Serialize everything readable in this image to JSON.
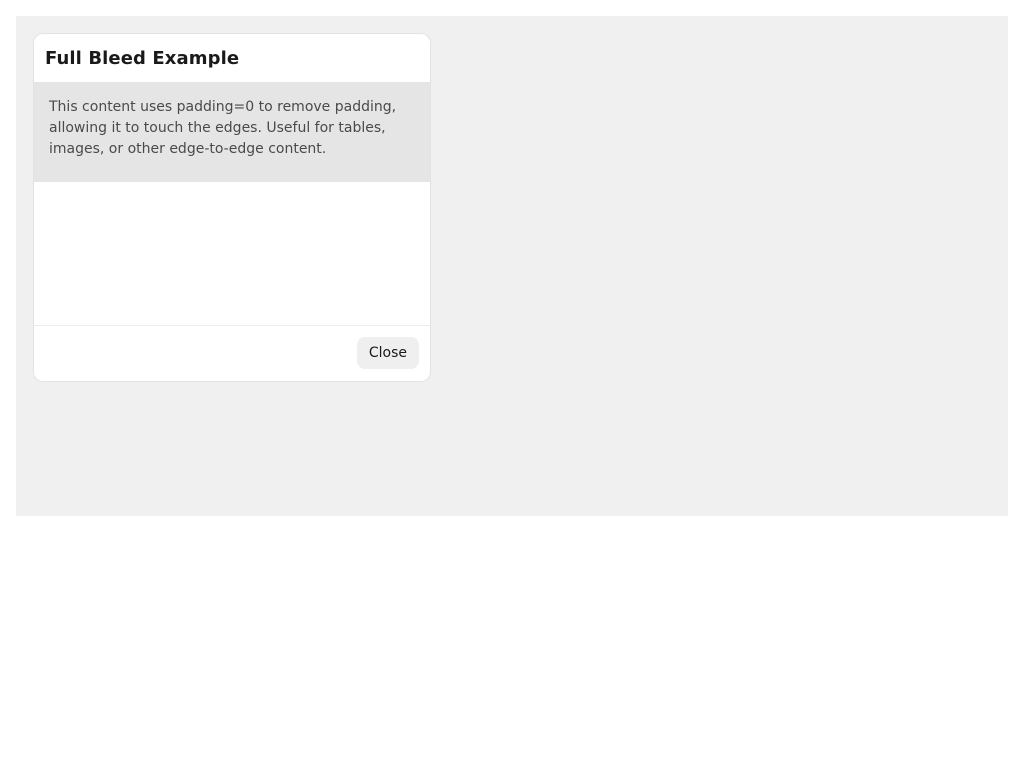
{
  "dialog": {
    "title": "Full Bleed Example",
    "content_text": "This content uses padding=0 to remove padding, allowing it to touch the edges. Useful for tables, images, or other edge-to-edge content.",
    "close_label": "Close"
  },
  "colors": {
    "stage_background": "#f0f0f0",
    "content_background": "#e5e5e5",
    "dialog_background": "#ffffff"
  }
}
